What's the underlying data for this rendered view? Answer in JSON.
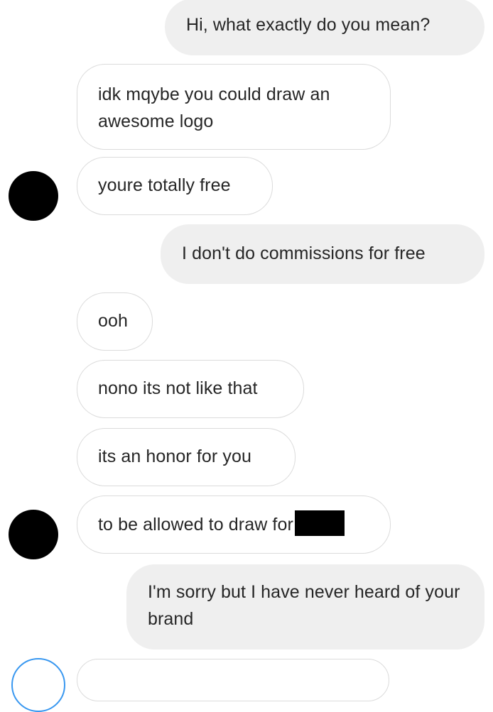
{
  "conversation": {
    "messages": [
      {
        "sender": "me",
        "text": "Hi, what exactly do you mean?"
      },
      {
        "sender": "them",
        "text": "idk mqybe you could draw an awesome logo"
      },
      {
        "sender": "them",
        "text": "youre totally free"
      },
      {
        "sender": "me",
        "text": "I don't do commissions for free"
      },
      {
        "sender": "them",
        "text": "ooh"
      },
      {
        "sender": "them",
        "text": "nono its not like that"
      },
      {
        "sender": "them",
        "text": "its an honor for you"
      },
      {
        "sender": "them",
        "text": "to be allowed to draw for"
      },
      {
        "sender": "me",
        "text": "I'm sorry but I have never heard of your brand"
      }
    ]
  },
  "colors": {
    "sent_bubble": "#efefef",
    "received_border": "#dbdbdb",
    "text": "#262626",
    "avatar": "#000000"
  }
}
